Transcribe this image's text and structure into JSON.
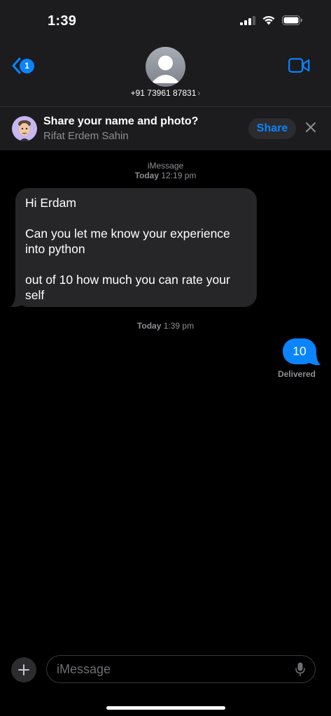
{
  "status_bar": {
    "time": "1:39"
  },
  "nav": {
    "unread_badge": "1",
    "contact_number": "+91 73961 87831",
    "chevron": "›"
  },
  "share_banner": {
    "title": "Share your name and photo?",
    "name": "Rifat Erdem Sahin",
    "share_label": "Share"
  },
  "conversation": {
    "service": "iMessage",
    "first_timestamp_day": "Today",
    "first_timestamp_time": "12:19 pm",
    "incoming_message": {
      "line1": "Hi Erdam",
      "line2": "Can you let me know your experience into python",
      "line3": "out of 10 how much you can rate your self"
    },
    "second_timestamp_day": "Today",
    "second_timestamp_time": "1:39 pm",
    "outgoing_message": "10",
    "delivery_status": "Delivered"
  },
  "compose": {
    "placeholder": "iMessage"
  },
  "colors": {
    "accent": "#0a84ff",
    "incoming_bubble": "#262628",
    "header_bg": "#1c1c1e",
    "secondary_text": "#8e8e93"
  }
}
